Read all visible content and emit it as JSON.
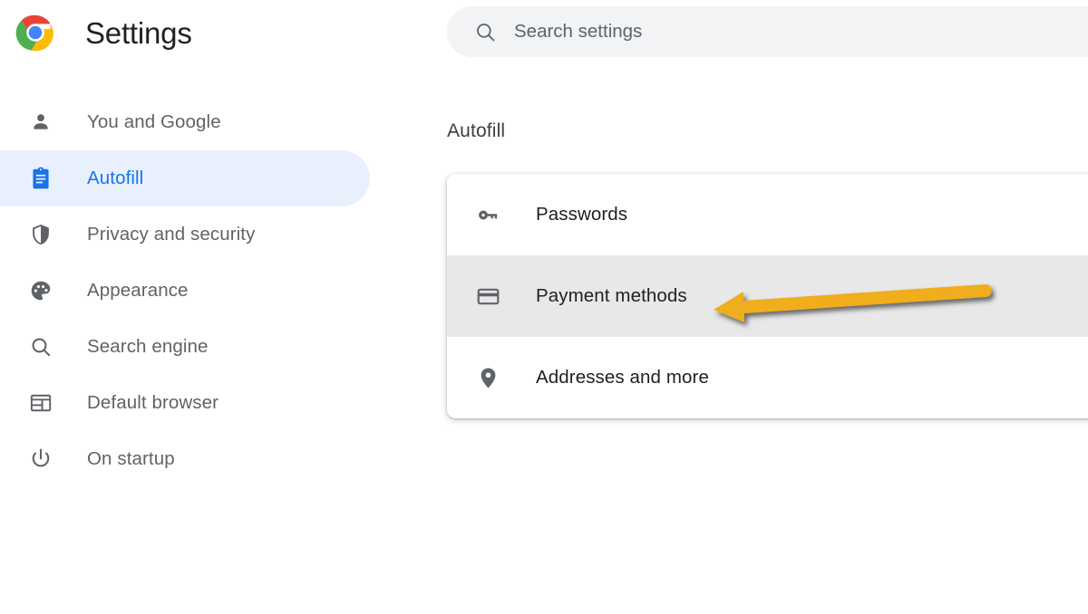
{
  "app": {
    "title": "Settings",
    "logo_icon": "chrome-logo-icon"
  },
  "search": {
    "placeholder": "Search settings",
    "value": "",
    "icon": "search-icon"
  },
  "sidebar": {
    "items": [
      {
        "label": "You and Google",
        "icon": "person-icon",
        "selected": false
      },
      {
        "label": "Autofill",
        "icon": "clipboard-icon",
        "selected": true
      },
      {
        "label": "Privacy and security",
        "icon": "shield-icon",
        "selected": false
      },
      {
        "label": "Appearance",
        "icon": "palette-icon",
        "selected": false
      },
      {
        "label": "Search engine",
        "icon": "search-icon",
        "selected": false
      },
      {
        "label": "Default browser",
        "icon": "browser-window-icon",
        "selected": false
      },
      {
        "label": "On startup",
        "icon": "power-icon",
        "selected": false
      }
    ]
  },
  "main": {
    "section_heading": "Autofill",
    "rows": [
      {
        "label": "Passwords",
        "icon": "key-icon",
        "highlighted": false
      },
      {
        "label": "Payment methods",
        "icon": "credit-card-icon",
        "highlighted": true
      },
      {
        "label": "Addresses and more",
        "icon": "location-pin-icon",
        "highlighted": false
      }
    ]
  },
  "annotation": {
    "type": "arrow",
    "points_to": "Payment methods",
    "direction": "left",
    "color": "#F0AD1E"
  },
  "colors": {
    "accent": "#1a73e8",
    "selected_pill_bg": "#e8f0fe",
    "row_highlight_bg": "#e8e8e8",
    "search_bg": "#f1f3f4",
    "text_primary": "#202124",
    "text_secondary": "#5f6368",
    "annotation": "#F0AD1E"
  }
}
